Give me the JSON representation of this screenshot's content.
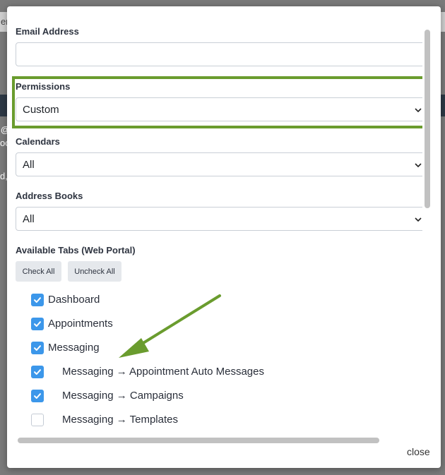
{
  "background": {
    "top_fragment": "en",
    "side_fragment_1": "@",
    "side_fragment_2": "oc",
    "side_fragment_3": "d,"
  },
  "form": {
    "email_label": "Email Address",
    "email_value": "",
    "permissions_label": "Permissions",
    "permissions_value": "Custom",
    "calendars_label": "Calendars",
    "calendars_value": "All",
    "address_books_label": "Address Books",
    "address_books_value": "All",
    "tabs_label": "Available Tabs (Web Portal)",
    "check_all_label": "Check All",
    "uncheck_all_label": "Uncheck All"
  },
  "tabs": [
    {
      "label": "Dashboard",
      "checked": true
    },
    {
      "label": "Appointments",
      "checked": true
    },
    {
      "label": "Messaging",
      "checked": true
    },
    {
      "label": "Messaging → Appointment Auto Messages",
      "checked": true
    },
    {
      "label": "Messaging → Campaigns",
      "checked": true
    },
    {
      "label": "Messaging → Templates",
      "checked": false
    }
  ],
  "footer": {
    "close_label": "close"
  },
  "colors": {
    "highlight": "#6a9c2e",
    "checkbox_on": "#3c97ea",
    "arrow": "#6a9c2e"
  }
}
